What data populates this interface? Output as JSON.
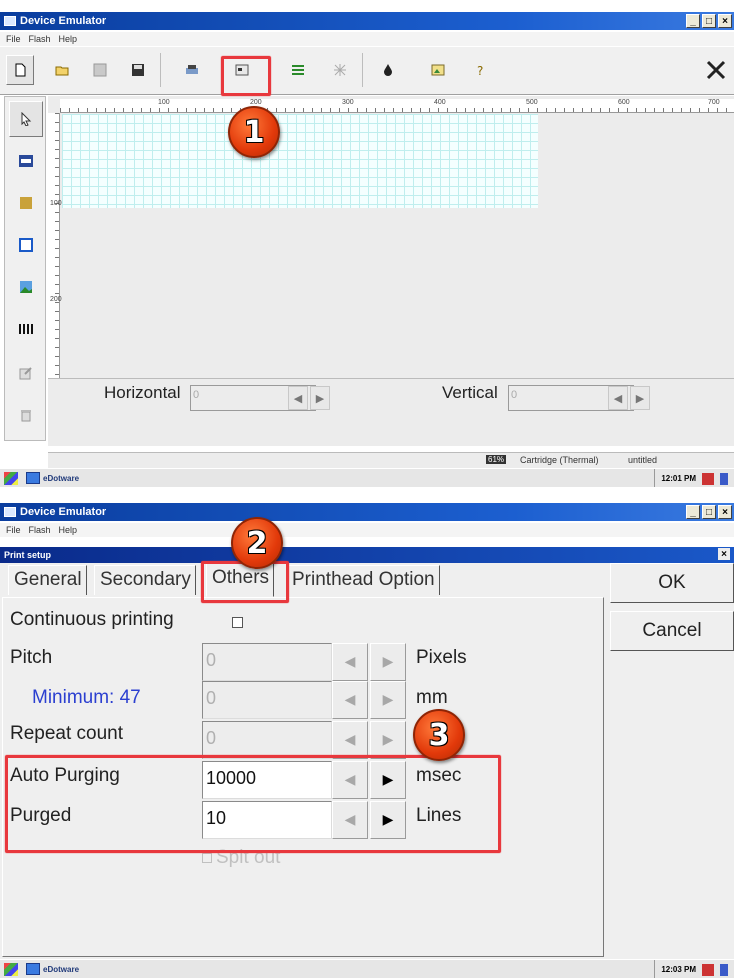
{
  "top": {
    "title": "Device Emulator",
    "menu": [
      "File",
      "Flash",
      "Help"
    ],
    "ruler_top_labels": [
      "100",
      "200",
      "300",
      "400",
      "500",
      "600",
      "700"
    ],
    "ruler_left_labels": [
      "100",
      "200"
    ],
    "horizontal_label": "Horizontal",
    "horizontal_value": "0",
    "vertical_label": "Vertical",
    "vertical_value": "0",
    "status_level": "61%",
    "status_cartridge": "Cartridge (Thermal)",
    "status_file": "untitled",
    "taskbar_app": "eDotware",
    "clock": "12:01 PM"
  },
  "bottom": {
    "title": "Device Emulator",
    "menu": [
      "File",
      "Flash",
      "Help"
    ],
    "dialog_title": "Print setup",
    "dialog_close": "×",
    "tabs": [
      "General",
      "Secondary",
      "Others",
      "Printhead Option"
    ],
    "continuous_printing_label": "Continuous printing",
    "pitch_label": "Pitch",
    "pitch_value": "0",
    "pitch_unit": "Pixels",
    "minimum_label": "Minimum: 47",
    "minimum_value": "0",
    "minimum_unit": "mm",
    "repeat_label": "Repeat count",
    "repeat_value": "0",
    "auto_purging_label": "Auto Purging",
    "auto_purging_value": "10000",
    "auto_purging_unit": "msec",
    "purged_label": "Purged",
    "purged_value": "10",
    "purged_unit": "Lines",
    "spit_out_label": "Spit out",
    "ok_label": "OK",
    "cancel_label": "Cancel",
    "taskbar_app": "eDotware",
    "clock": "12:03 PM"
  },
  "annotations": [
    "1",
    "2",
    "3"
  ],
  "colors": {
    "accent_red": "#e8383d",
    "badge_orange": "#e2390a",
    "title_blue": "#0a246a",
    "minimum_blue": "#2b3fd0"
  },
  "icons": {
    "toolbar": [
      "new-file-icon",
      "open-folder-icon",
      "save-disabled-icon",
      "save-icon",
      "printer-settings-icon",
      "print-setup-icon",
      "lines-icon",
      "grid-icon",
      "ink-drop-icon",
      "image-edit-icon",
      "help-icon",
      "close-x-icon"
    ],
    "tools": [
      "pointer-icon",
      "text-tool-icon",
      "counter-tool-icon",
      "date-tool-icon",
      "image-tool-icon",
      "barcode-tool-icon",
      "edit-tool-icon",
      "delete-tool-icon"
    ]
  }
}
